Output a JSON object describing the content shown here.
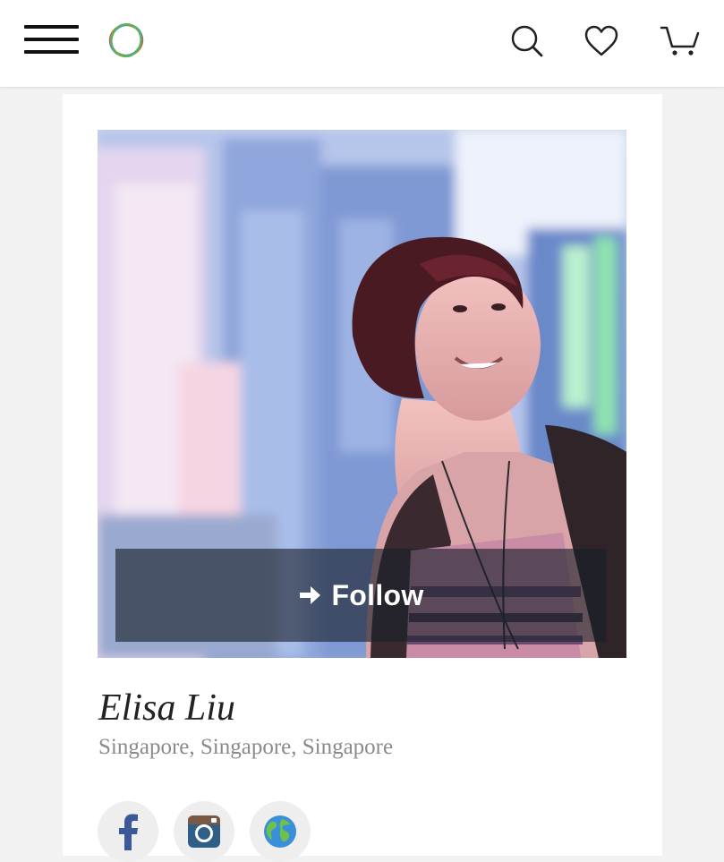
{
  "header": {
    "menu_icon": "hamburger-menu-icon",
    "logo_icon": "multicolor-rings-logo",
    "search_icon": "search-icon",
    "wishlist_icon": "heart-icon",
    "cart_icon": "cart-icon"
  },
  "profile": {
    "photo_alt": "Profile photo",
    "follow_label": "Follow",
    "follow_icon": "arrow-right-icon",
    "name": "Elisa Liu",
    "location": "Singapore, Singapore, Singapore"
  },
  "social_links": [
    {
      "icon": "facebook-icon",
      "color": "#3b5998"
    },
    {
      "icon": "instagram-icon",
      "color": "#2f5f86"
    },
    {
      "icon": "globe-icon",
      "color": "#3a8fd9"
    }
  ],
  "colors": {
    "background": "#f2f2f2",
    "card": "#ffffff",
    "name_text": "#222222",
    "location_text": "#8a8a8a",
    "follow_overlay": "#191e28"
  }
}
